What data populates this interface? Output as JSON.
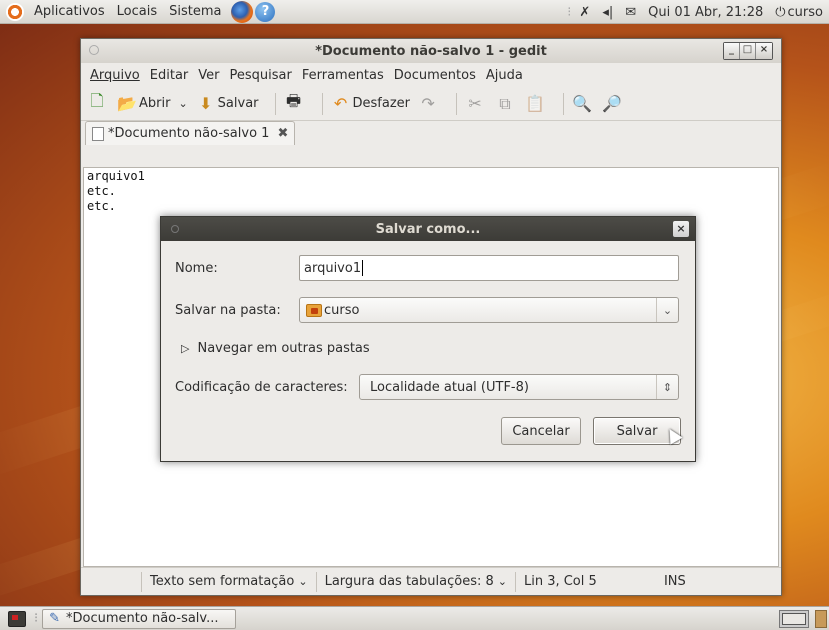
{
  "top_panel": {
    "menus": [
      "Aplicativos",
      "Locais",
      "Sistema"
    ],
    "clock": "Qui 01 Abr, 21:28",
    "user": "curso"
  },
  "window": {
    "title": "*Documento não-salvo 1 - gedit",
    "menu": [
      "Arquivo",
      "Editar",
      "Ver",
      "Pesquisar",
      "Ferramentas",
      "Documentos",
      "Ajuda"
    ],
    "toolbar": {
      "open": "Abrir",
      "save": "Salvar",
      "undo": "Desfazer"
    },
    "tab_label": "*Documento não-salvo 1",
    "editor_lines": [
      "arquivo1",
      "etc.",
      "etc."
    ],
    "status": {
      "format": "Texto sem formatação",
      "tab_width": "Largura das tabulações: 8",
      "position": "Lin 3, Col 5",
      "mode": "INS"
    }
  },
  "dialog": {
    "title": "Salvar como...",
    "name_label": "Nome:",
    "name_value": "arquivo1",
    "folder_label": "Salvar na pasta:",
    "folder_value": "curso",
    "browse_label": "Navegar em outras pastas",
    "encoding_label": "Codificação de caracteres:",
    "encoding_value": "Localidade atual (UTF-8)",
    "cancel": "Cancelar",
    "save": "Salvar"
  },
  "taskbar": {
    "item": "*Documento não-salv..."
  }
}
